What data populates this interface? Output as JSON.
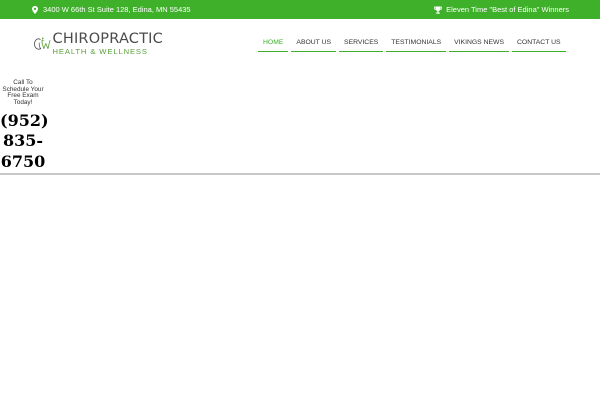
{
  "topbar": {
    "address": "3400 W 66th St Suite 128, Edina, MN 55435",
    "award": "Eleven Time \"Best of Edina\" Winners",
    "icons": {
      "address": "map-pin-icon",
      "award": "trophy-icon"
    },
    "background": "#3fb02a"
  },
  "logo": {
    "name": "CHIROPRACTIC",
    "tagline": "HEALTH & WELLNESS"
  },
  "nav": {
    "items": [
      {
        "label": "HOME",
        "active": true
      },
      {
        "label": "ABOUT US",
        "active": false
      },
      {
        "label": "SERVICES",
        "active": false
      },
      {
        "label": "TESTIMONIALS",
        "active": false
      },
      {
        "label": "VIKINGS NEWS",
        "active": false
      },
      {
        "label": "CONTACT US",
        "active": false
      }
    ]
  },
  "cta": {
    "text": "Call To Schedule Your Free Exam Today!",
    "phone_lines": [
      "(952)",
      "835-",
      "6750"
    ]
  },
  "colors": {
    "accent": "#3fb02a",
    "text": "#333333",
    "divider": "#c8c8c8"
  }
}
